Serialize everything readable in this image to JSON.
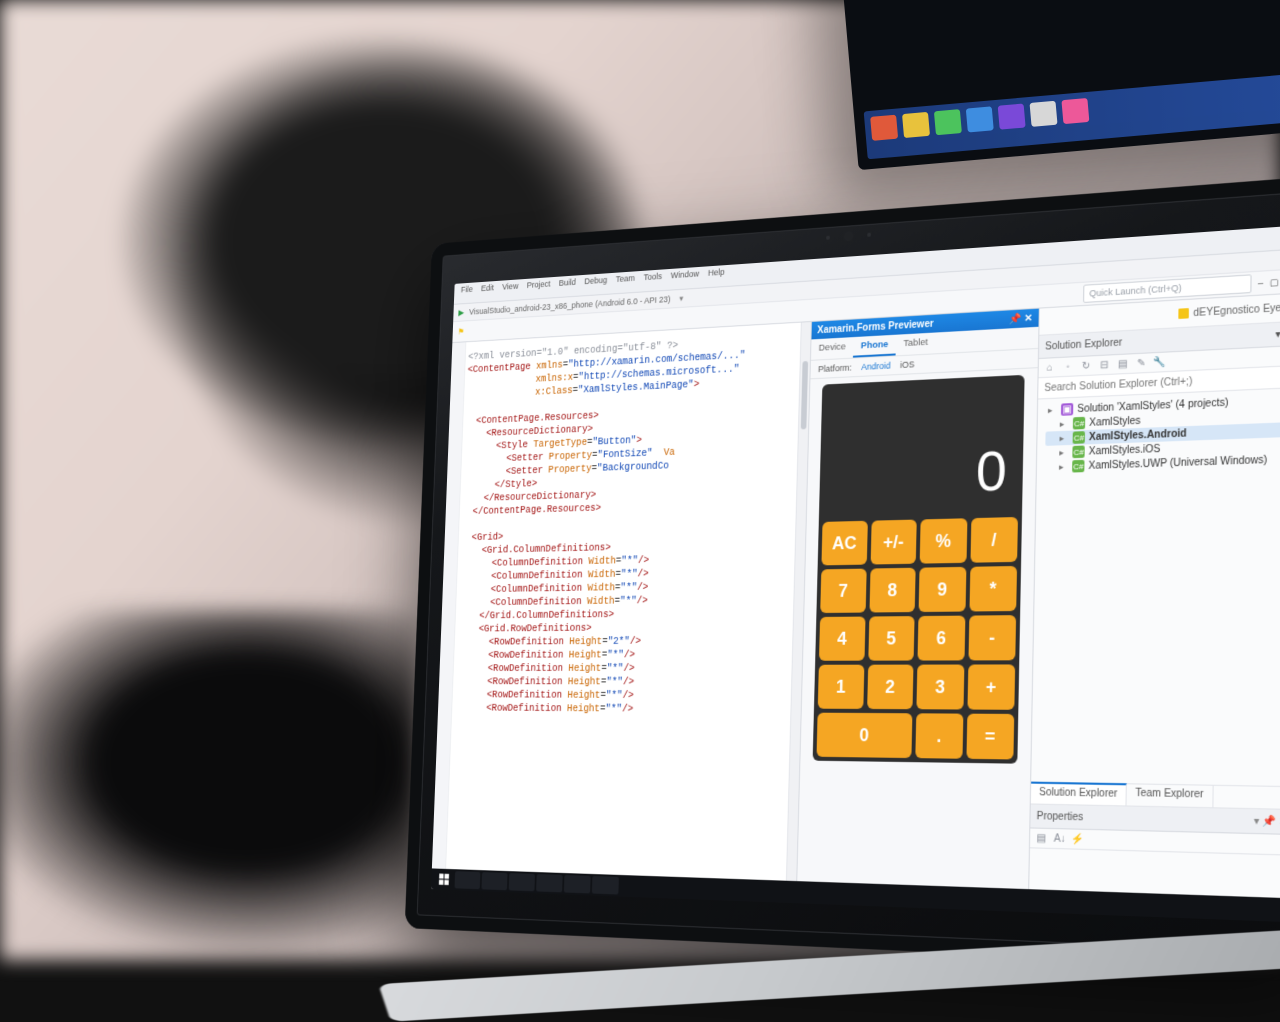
{
  "menubar": [
    "File",
    "Edit",
    "View",
    "Project",
    "Build",
    "Debug",
    "Team",
    "Tools",
    "Window",
    "Help"
  ],
  "toolbar": {
    "debug_target": "VisualStudio_android-23_x86_phone (Android 6.0 - API 23)",
    "quick_launch_placeholder": "Quick Launch (Ctrl+Q)"
  },
  "account": "dEYEgnostico Eyeur",
  "previewer": {
    "title": "Xamarin.Forms Previewer",
    "device_tabs": [
      "Device",
      "Phone",
      "Tablet"
    ],
    "platform_label": "Platform:",
    "platforms": [
      "Android",
      "iOS"
    ]
  },
  "calculator": {
    "display": "0",
    "keys": [
      "AC",
      "+/-",
      "%",
      "/",
      "7",
      "8",
      "9",
      "*",
      "4",
      "5",
      "6",
      "-",
      "1",
      "2",
      "3",
      "+",
      "0",
      ".",
      "="
    ]
  },
  "solution_explorer": {
    "title": "Solution Explorer",
    "search_placeholder": "Search Solution Explorer (Ctrl+;)",
    "solution_label": "Solution 'XamlStyles' (4 projects)",
    "projects": [
      "XamlStyles",
      "XamlStyles.Android",
      "XamlStyles.iOS",
      "XamlStyles.UWP (Universal Windows)"
    ],
    "tabs": [
      "Solution Explorer",
      "Team Explorer"
    ]
  },
  "properties": {
    "title": "Properties"
  },
  "code": {
    "line1": "<?xml version=\"1.0\" encoding=\"utf-8\" ?>",
    "line2": "<ContentPage xmlns=\"http://xamarin.com/schemas/...\"",
    "line3": "             xmlns:x=\"http://schemas.microsoft...\"",
    "line4": "             x:Class=\"XamlStyles.MainPage\">",
    "line5": "",
    "line6": "  <ContentPage.Resources>",
    "line7": "    <ResourceDictionary>",
    "line8": "      <Style TargetType=\"Button\">",
    "line9": "        <Setter Property=\"FontSize\"  Va...",
    "line10": "        <Setter Property=\"BackgroundCo...",
    "line11": "      </Style>",
    "line12": "    </ResourceDictionary>",
    "line13": "  </ContentPage.Resources>",
    "line14": "",
    "line15": "  <Grid>",
    "line16": "    <Grid.ColumnDefinitions>",
    "line17": "      <ColumnDefinition Width=\"*\"/>",
    "line18": "      <ColumnDefinition Width=\"*\"/>",
    "line19": "      <ColumnDefinition Width=\"*\"/>",
    "line20": "      <ColumnDefinition Width=\"*\"/>",
    "line21": "    </Grid.ColumnDefinitions>",
    "line22": "    <Grid.RowDefinitions>",
    "line23": "      <RowDefinition Height=\"2*\"/>",
    "line24": "      <RowDefinition Height=\"*\"/>",
    "line25": "      <RowDefinition Height=\"*\"/>",
    "line26": "      <RowDefinition Height=\"*\"/>",
    "line27": "      <RowDefinition Height=\"*\"/>",
    "line28": "      <RowDefinition Height=\"*\"/>"
  }
}
